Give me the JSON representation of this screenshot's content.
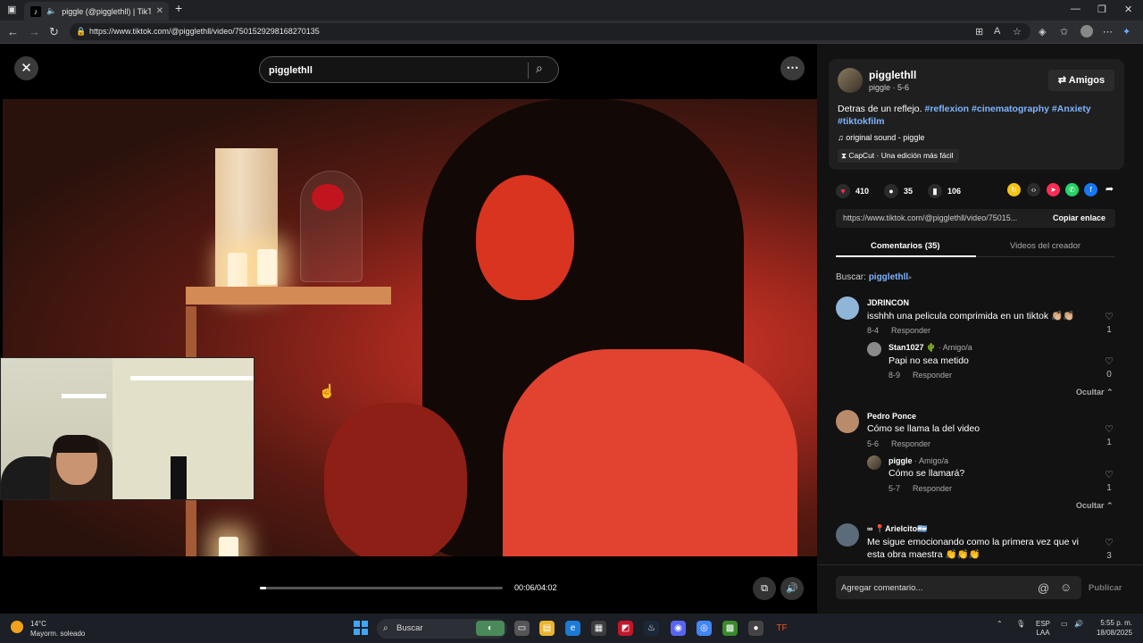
{
  "browser": {
    "tab_title": "piggle (@pigglethll) | TikTok",
    "url": "https://www.tiktok.com/@pigglethll/video/7501529298168270135"
  },
  "player": {
    "search_value": "pigglethll",
    "current_time": "00:06/04:02",
    "progress_fraction": 0.025
  },
  "author": {
    "username": "pigglethll",
    "subline": "piggle · 5-6",
    "friends_button": "Amigos"
  },
  "post": {
    "description": "Detras de un reflejo.",
    "hashtags": [
      "#reflexion",
      "#cinematography",
      "#Anxiety",
      "#tiktokfilm"
    ],
    "sound": "original sound - piggle",
    "capcut": "CapCut · Una edición más fácil"
  },
  "stats": {
    "likes": "410",
    "comments": "35",
    "saves": "106"
  },
  "share_colors": [
    "#f5c518",
    "#2b2b2b",
    "#fe2c55",
    "#25d366",
    "#1877f2"
  ],
  "link": {
    "url": "https://www.tiktok.com/@pigglethll/video/75015...",
    "copy_label": "Copiar enlace"
  },
  "tabs": {
    "comments": "Comentarios (35)",
    "creator_videos": "Videos del creador"
  },
  "search_suggestion": {
    "prefix": "Buscar:",
    "query": "pigglethll"
  },
  "comments": [
    {
      "user": "JDRINCON",
      "text": "isshhh una pelicula comprimida en un tiktok 👏🏼👏🏼",
      "date": "8-4",
      "reply": "Responder",
      "likes": "1",
      "replies": [
        {
          "user": "Stan1027 🌵",
          "badge": "· Amigo/a",
          "text": "Papi no sea metido",
          "date": "8-9",
          "reply": "Responder",
          "likes": "0"
        }
      ],
      "hide": "Ocultar"
    },
    {
      "user": "Pedro Ponce",
      "text": "Cómo se llama la del video",
      "date": "5-6",
      "reply": "Responder",
      "likes": "1",
      "replies": [
        {
          "user": "piggle",
          "badge": "· Amigo/a",
          "text": "Cómo se llamará?",
          "date": "5-7",
          "reply": "Responder",
          "likes": "1"
        }
      ],
      "hide": "Ocultar"
    },
    {
      "user": "∞ 📍Arielcito🇦🇷",
      "text": "Me sigue emocionando como la primera vez que vi esta obra maestra 👏👏👏",
      "likes": "3"
    }
  ],
  "comment_input": {
    "placeholder": "Agregar comentario...",
    "post_label": "Publicar"
  },
  "taskbar": {
    "temp": "14°C",
    "weather": "Mayorm. soleado",
    "search": "Buscar",
    "lang1": "ESP",
    "lang2": "LAA",
    "time": "5:55 p. m.",
    "date": "18/08/2025"
  }
}
